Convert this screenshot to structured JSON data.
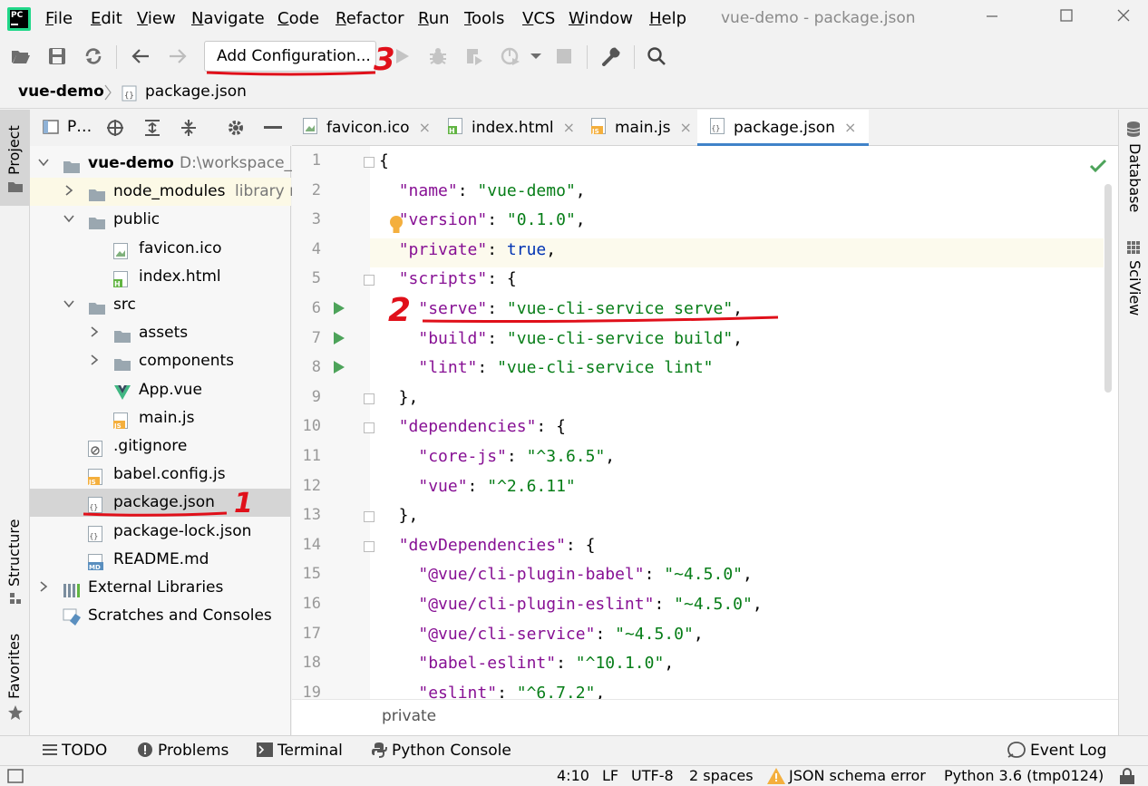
{
  "window": {
    "title": "vue-demo - package.json",
    "logo_text": "PC",
    "menu": [
      "File",
      "Edit",
      "View",
      "Navigate",
      "Code",
      "Refactor",
      "Run",
      "Tools",
      "VCS",
      "Window",
      "Help"
    ],
    "menu_underline": [
      "F",
      "E",
      "V",
      "N",
      "C",
      "R",
      "R",
      "T",
      "V",
      "W",
      "H"
    ]
  },
  "toolbar": {
    "run_config_label": "Add Configuration..."
  },
  "breadcrumb": {
    "project": "vue-demo",
    "file": "package.json"
  },
  "left_strip": {
    "project": "Project",
    "structure": "Structure",
    "favorites": "Favorites"
  },
  "right_strip": {
    "database": "Database",
    "sciview": "SciView"
  },
  "project_panel": {
    "header_label": "P…",
    "tree": [
      {
        "label": "vue-demo",
        "extra": "D:\\workspace_p",
        "bold": true,
        "depth": 0,
        "arrow": "down",
        "icon": "folder-icon"
      },
      {
        "label": "node_modules",
        "extra": "library root",
        "depth": 1,
        "arrow": "right",
        "icon": "folder-icon"
      },
      {
        "label": "public",
        "extra": "",
        "depth": 1,
        "arrow": "down",
        "icon": "folder-icon"
      },
      {
        "label": "favicon.ico",
        "extra": "",
        "depth": 2,
        "arrow": "",
        "icon": "image-file-icon"
      },
      {
        "label": "index.html",
        "extra": "",
        "depth": 2,
        "arrow": "",
        "icon": "html-file-icon"
      },
      {
        "label": "src",
        "extra": "",
        "depth": 1,
        "arrow": "down",
        "icon": "folder-icon"
      },
      {
        "label": "assets",
        "extra": "",
        "depth": 2,
        "arrow": "right",
        "icon": "folder-icon"
      },
      {
        "label": "components",
        "extra": "",
        "depth": 2,
        "arrow": "right",
        "icon": "folder-icon"
      },
      {
        "label": "App.vue",
        "extra": "",
        "depth": 2,
        "arrow": "",
        "icon": "vue-file-icon"
      },
      {
        "label": "main.js",
        "extra": "",
        "depth": 2,
        "arrow": "",
        "icon": "js-file-icon"
      },
      {
        "label": ".gitignore",
        "extra": "",
        "depth": 1,
        "arrow": "",
        "icon": "gitignore-file-icon"
      },
      {
        "label": "babel.config.js",
        "extra": "",
        "depth": 1,
        "arrow": "",
        "icon": "js-file-icon"
      },
      {
        "label": "package.json",
        "extra": "",
        "depth": 1,
        "arrow": "",
        "icon": "json-file-icon",
        "selected": true
      },
      {
        "label": "package-lock.json",
        "extra": "",
        "depth": 1,
        "arrow": "",
        "icon": "json-file-icon"
      },
      {
        "label": "README.md",
        "extra": "",
        "depth": 1,
        "arrow": "",
        "icon": "markdown-file-icon"
      },
      {
        "label": "External Libraries",
        "extra": "",
        "depth": 0,
        "arrow": "right",
        "icon": "libraries-icon"
      },
      {
        "label": "Scratches and Consoles",
        "extra": "",
        "depth": 0,
        "arrow": "",
        "icon": "scratches-icon"
      }
    ]
  },
  "tabs": [
    {
      "label": "favicon.ico",
      "icon": "image-file-icon",
      "active": false
    },
    {
      "label": "index.html",
      "icon": "html-file-icon",
      "active": false
    },
    {
      "label": "main.js",
      "icon": "js-file-icon",
      "active": false
    },
    {
      "label": "package.json",
      "icon": "json-file-icon",
      "active": true
    }
  ],
  "tab_close_symbol": "×",
  "editor": {
    "lines": [
      {
        "n": "1",
        "parts": [
          [
            "p",
            "{"
          ]
        ]
      },
      {
        "n": "2",
        "parts": [
          [
            "p",
            "  "
          ],
          [
            "k",
            "\"name\""
          ],
          [
            "p",
            ": "
          ],
          [
            "s",
            "\"vue-demo\""
          ],
          [
            "p",
            ","
          ]
        ]
      },
      {
        "n": "3",
        "parts": [
          [
            "p",
            "  "
          ],
          [
            "k",
            "\"version\""
          ],
          [
            "p",
            ": "
          ],
          [
            "s",
            "\"0.1.0\""
          ],
          [
            "p",
            ","
          ]
        ]
      },
      {
        "n": "4",
        "parts": [
          [
            "p",
            "  "
          ],
          [
            "k",
            "\"private\""
          ],
          [
            "p",
            ": "
          ],
          [
            "b",
            "true"
          ],
          [
            "p",
            ","
          ]
        ]
      },
      {
        "n": "5",
        "parts": [
          [
            "p",
            "  "
          ],
          [
            "k",
            "\"scripts\""
          ],
          [
            "p",
            ": {"
          ]
        ]
      },
      {
        "n": "6",
        "parts": [
          [
            "p",
            "    "
          ],
          [
            "k",
            "\"serve\""
          ],
          [
            "p",
            ": "
          ],
          [
            "s",
            "\"vue-cli-service serve\""
          ],
          [
            "p",
            ","
          ]
        ]
      },
      {
        "n": "7",
        "parts": [
          [
            "p",
            "    "
          ],
          [
            "k",
            "\"build\""
          ],
          [
            "p",
            ": "
          ],
          [
            "s",
            "\"vue-cli-service build\""
          ],
          [
            "p",
            ","
          ]
        ]
      },
      {
        "n": "8",
        "parts": [
          [
            "p",
            "    "
          ],
          [
            "k",
            "\"lint\""
          ],
          [
            "p",
            ": "
          ],
          [
            "s",
            "\"vue-cli-service lint\""
          ]
        ]
      },
      {
        "n": "9",
        "parts": [
          [
            "p",
            "  },"
          ]
        ]
      },
      {
        "n": "10",
        "parts": [
          [
            "p",
            "  "
          ],
          [
            "k",
            "\"dependencies\""
          ],
          [
            "p",
            ": {"
          ]
        ]
      },
      {
        "n": "11",
        "parts": [
          [
            "p",
            "    "
          ],
          [
            "k",
            "\"core-js\""
          ],
          [
            "p",
            ": "
          ],
          [
            "s",
            "\"^3.6.5\""
          ],
          [
            "p",
            ","
          ]
        ]
      },
      {
        "n": "12",
        "parts": [
          [
            "p",
            "    "
          ],
          [
            "k",
            "\"vue\""
          ],
          [
            "p",
            ": "
          ],
          [
            "s",
            "\"^2.6.11\""
          ]
        ]
      },
      {
        "n": "13",
        "parts": [
          [
            "p",
            "  },"
          ]
        ]
      },
      {
        "n": "14",
        "parts": [
          [
            "p",
            "  "
          ],
          [
            "k",
            "\"devDependencies\""
          ],
          [
            "p",
            ": {"
          ]
        ]
      },
      {
        "n": "15",
        "parts": [
          [
            "p",
            "    "
          ],
          [
            "k",
            "\"@vue/cli-plugin-babel\""
          ],
          [
            "p",
            ": "
          ],
          [
            "s",
            "\"~4.5.0\""
          ],
          [
            "p",
            ","
          ]
        ]
      },
      {
        "n": "16",
        "parts": [
          [
            "p",
            "    "
          ],
          [
            "k",
            "\"@vue/cli-plugin-eslint\""
          ],
          [
            "p",
            ": "
          ],
          [
            "s",
            "\"~4.5.0\""
          ],
          [
            "p",
            ","
          ]
        ]
      },
      {
        "n": "17",
        "parts": [
          [
            "p",
            "    "
          ],
          [
            "k",
            "\"@vue/cli-service\""
          ],
          [
            "p",
            ": "
          ],
          [
            "s",
            "\"~4.5.0\""
          ],
          [
            "p",
            ","
          ]
        ]
      },
      {
        "n": "18",
        "parts": [
          [
            "p",
            "    "
          ],
          [
            "k",
            "\"babel-eslint\""
          ],
          [
            "p",
            ": "
          ],
          [
            "s",
            "\"^10.1.0\""
          ],
          [
            "p",
            ","
          ]
        ]
      },
      {
        "n": "19",
        "parts": [
          [
            "p",
            "    "
          ],
          [
            "k",
            "\"eslint\""
          ],
          [
            "p",
            ": "
          ],
          [
            "s",
            "\"^6.7.2\""
          ],
          [
            "p",
            ","
          ]
        ]
      }
    ],
    "run_lines": [
      "6",
      "7",
      "8"
    ],
    "fold_lines": [
      "1",
      "5",
      "9",
      "10",
      "13",
      "14"
    ],
    "breadcrumb_path": "private"
  },
  "bottom_tools": {
    "todo": "TODO",
    "problems": "Problems",
    "terminal": "Terminal",
    "python_console": "Python Console",
    "event_log": "Event Log"
  },
  "status": {
    "position": "4:10",
    "line_sep": "LF",
    "encoding": "UTF-8",
    "indent": "2 spaces",
    "schema": "JSON schema error",
    "interpreter": "Python 3.6 (tmp0124)"
  },
  "annotations": {
    "one": "1",
    "two": "2",
    "three": "3"
  },
  "colors": {
    "accent": "#4083c9",
    "key": "#871094",
    "string": "#067d17",
    "keyword": "#0033b3",
    "annotation": "#e0101a",
    "run": "#4da35a"
  }
}
